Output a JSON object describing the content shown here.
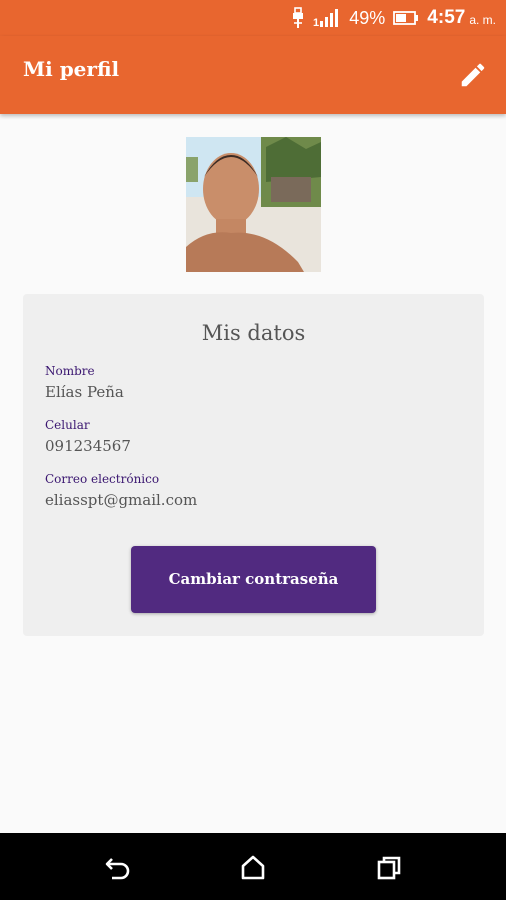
{
  "status_bar": {
    "battery_percent": "49%",
    "time": "4:57",
    "ampm": "a. m.",
    "icons": [
      "usb-icon",
      "signal-icon",
      "battery-icon"
    ]
  },
  "app_bar": {
    "title": "Mi perfil",
    "edit_icon": "pencil-edit-icon",
    "color": "#e8662f"
  },
  "profile": {
    "card_title": "Mis datos",
    "fields": [
      {
        "label": "Nombre",
        "value": "Elías Peña"
      },
      {
        "label": "Celular",
        "value": "091234567"
      },
      {
        "label": "Correo electrónico",
        "value": "eliasspt@gmail.com"
      }
    ],
    "change_password_label": "Cambiar contraseña",
    "button_color": "#512a80"
  },
  "nav_bar": {
    "icons": [
      "back-icon",
      "home-icon",
      "recents-icon"
    ]
  }
}
